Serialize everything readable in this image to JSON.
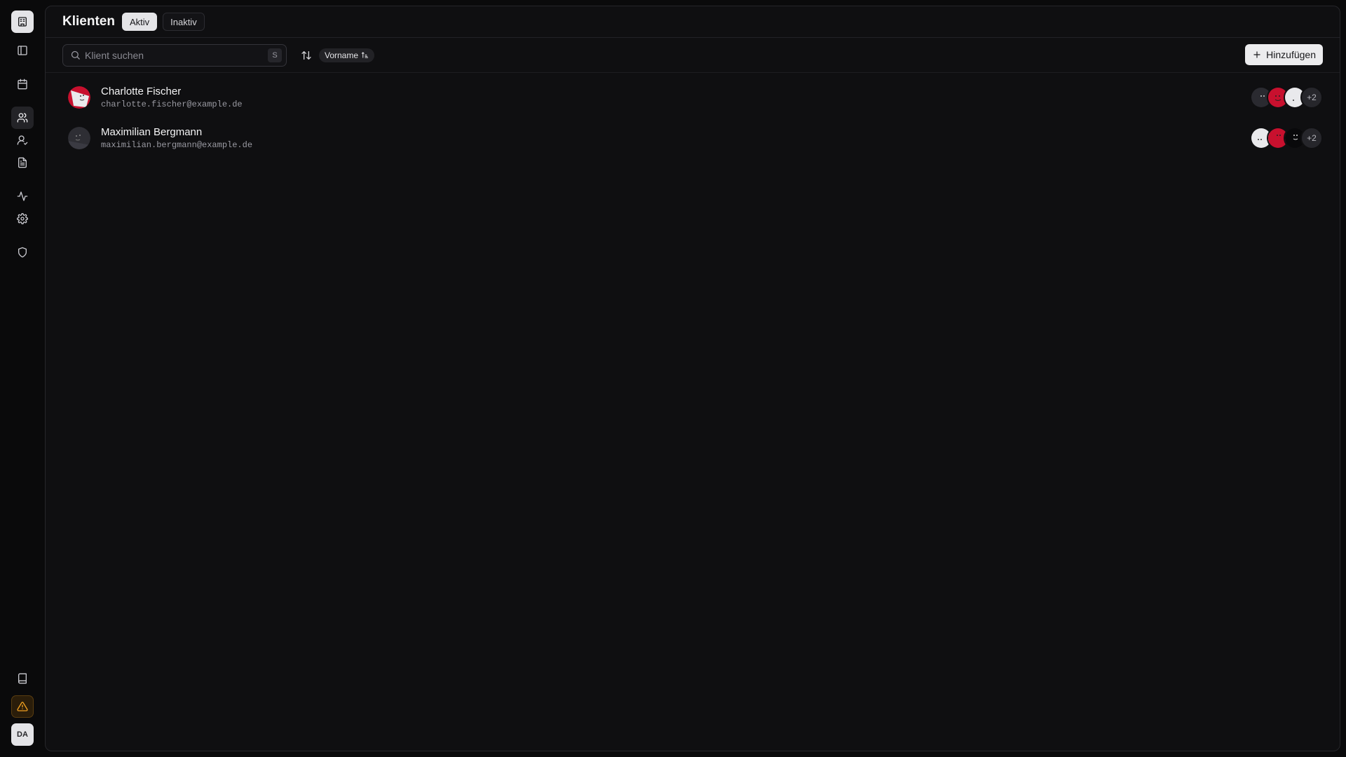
{
  "sidebar": {
    "top": [
      {
        "icon": "building-icon",
        "active": false
      },
      {
        "icon": "sidebar-toggle-icon",
        "active": false
      },
      {
        "icon": "calendar-icon",
        "active": false
      },
      {
        "icon": "users-icon",
        "active": true
      },
      {
        "icon": "user-check-icon",
        "active": false
      },
      {
        "icon": "document-icon",
        "active": false
      },
      {
        "icon": "activity-icon",
        "active": false
      },
      {
        "icon": "settings-icon",
        "active": false
      },
      {
        "icon": "shield-icon",
        "active": false
      }
    ],
    "bottom": {
      "book_icon": "book-icon",
      "warning_icon": "warning-icon",
      "user_initials": "DA"
    }
  },
  "header": {
    "title": "Klienten",
    "tabs": [
      {
        "label": "Aktiv",
        "active": true
      },
      {
        "label": "Inaktiv",
        "active": false
      }
    ]
  },
  "toolbar": {
    "search_placeholder": "Klient suchen",
    "search_value": "",
    "search_shortcut": "S",
    "sort_label": "Vorname",
    "add_label": "Hinzufügen"
  },
  "clients": [
    {
      "name": "Charlotte Fischer",
      "email": "charlotte.fischer@example.de",
      "avatar_colors": [
        "#c8102e",
        "#e9e9ec"
      ],
      "team_colors": [
        "#2a2a30",
        "#c8102e",
        "#e9e9ec"
      ],
      "team_more": "+2"
    },
    {
      "name": "Maximilian Bergmann",
      "email": "maximilian.bergmann@example.de",
      "avatar_colors": [
        "#2e2e34",
        "#3a3a42"
      ],
      "team_colors": [
        "#e9e9ec",
        "#c8102e",
        "#09090b"
      ],
      "team_more": "+2"
    }
  ],
  "colors": {
    "background": "#0a0a0b",
    "panel": "#0f0f11",
    "accent_red": "#c8102e",
    "warning": "#f0a020"
  }
}
